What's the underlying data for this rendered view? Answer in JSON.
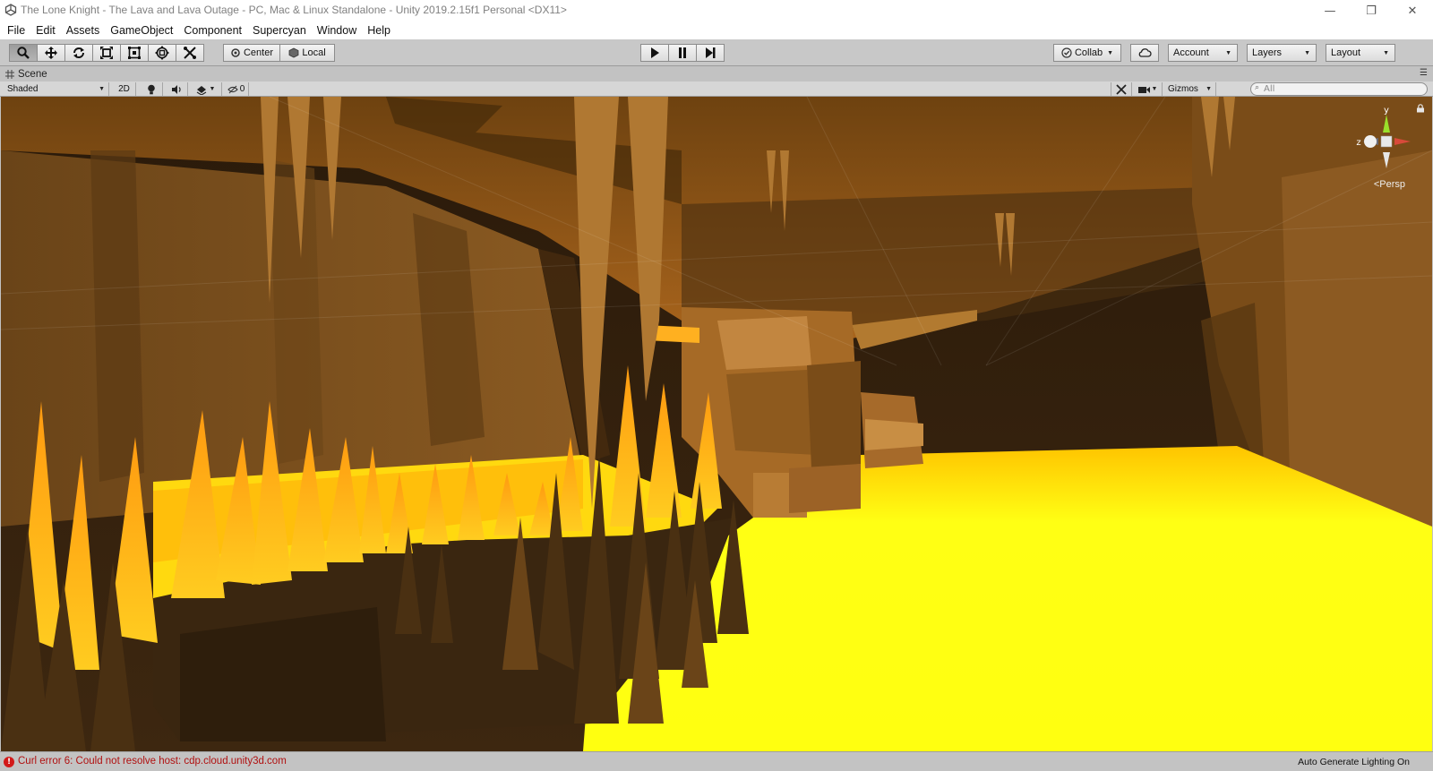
{
  "window": {
    "title": "The Lone Knight - The Lava and Lava Outage - PC, Mac & Linux Standalone - Unity 2019.2.15f1 Personal <DX11>",
    "minimize_glyph": "—",
    "restore_glyph": "❐",
    "close_glyph": "✕"
  },
  "menu": {
    "items": [
      "File",
      "Edit",
      "Assets",
      "GameObject",
      "Component",
      "Supercyan",
      "Window",
      "Help"
    ]
  },
  "toolbar": {
    "tools": [
      "hand-icon",
      "move-icon",
      "rotate-icon",
      "scale-icon",
      "rect-icon",
      "transform-icon",
      "custom-tool-icon"
    ],
    "pivot_label": "Center",
    "space_label": "Local",
    "collab_label": "Collab",
    "account_label": "Account",
    "layers_label": "Layers",
    "layout_label": "Layout"
  },
  "scene_tab": {
    "label": "Scene",
    "shading_mode": "Shaded",
    "mode_2d": "2D",
    "hidden_count": "0",
    "gizmos_label": "Gizmos",
    "search_placeholder": "All",
    "axis_y": "y",
    "axis_z": "z",
    "projection_label": "Persp"
  },
  "status": {
    "error_glyph": "!",
    "error_message": "Curl error 6: Could not resolve host: cdp.cloud.unity3d.com",
    "lighting_label": "Auto Generate Lighting On"
  },
  "colors": {
    "lava": "#ffff14",
    "rock": "#7a4a1a",
    "ceiling": "#8a5518",
    "error": "#d21a1a"
  }
}
